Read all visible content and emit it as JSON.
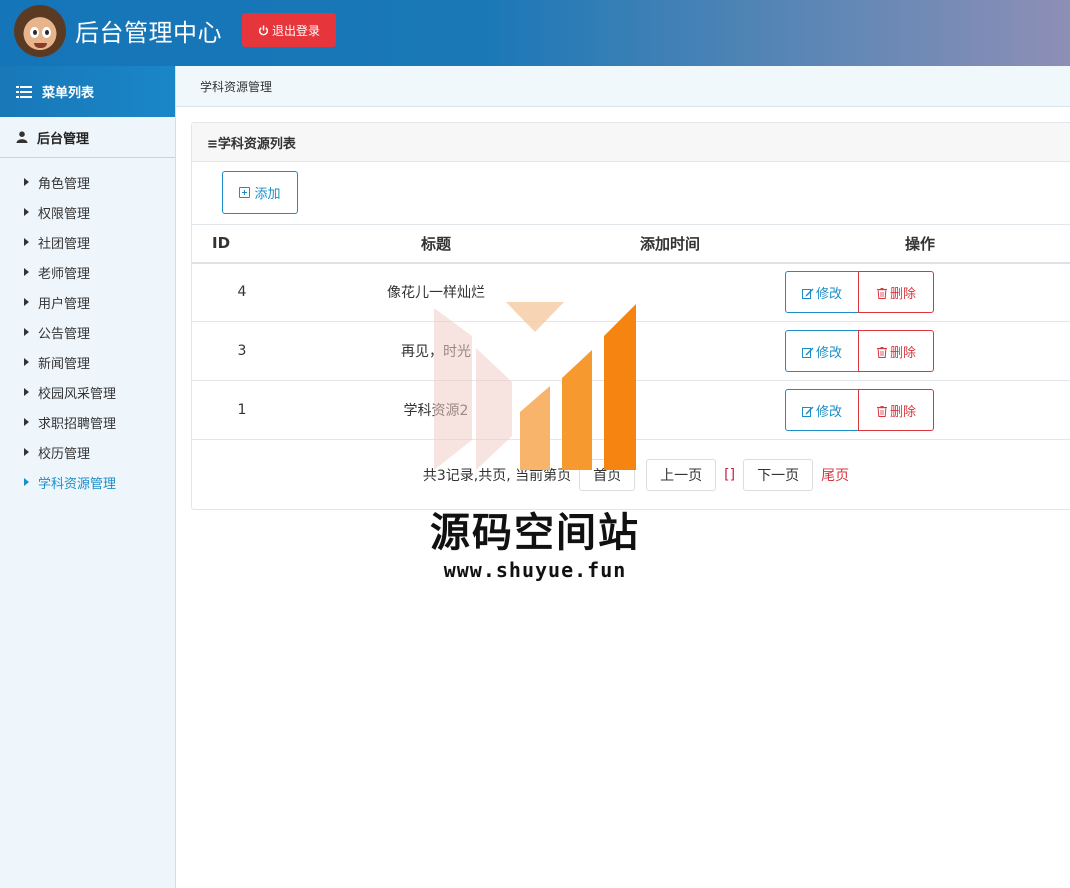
{
  "header": {
    "title": "后台管理中心",
    "logout_label": "退出登录"
  },
  "sidebar": {
    "menu_title": "菜单列表",
    "group_title": "后台管理",
    "items": [
      {
        "label": "角色管理"
      },
      {
        "label": "权限管理"
      },
      {
        "label": "社团管理"
      },
      {
        "label": "老师管理"
      },
      {
        "label": "用户管理"
      },
      {
        "label": "公告管理"
      },
      {
        "label": "新闻管理"
      },
      {
        "label": "校园风采管理"
      },
      {
        "label": "求职招聘管理"
      },
      {
        "label": "校历管理"
      },
      {
        "label": "学科资源管理",
        "active": true
      }
    ]
  },
  "breadcrumb": "学科资源管理",
  "panel": {
    "title": "≡学科资源列表",
    "add_label": "添加"
  },
  "table": {
    "headers": {
      "id": "ID",
      "title": "标题",
      "time": "添加时间",
      "op": "操作"
    },
    "rows": [
      {
        "id": "4",
        "title": "像花儿一样灿烂",
        "time": ""
      },
      {
        "id": "3",
        "title": "再见，时光",
        "time": ""
      },
      {
        "id": "1",
        "title": "学科资源2",
        "time": ""
      }
    ],
    "edit_label": "修改",
    "delete_label": "删除"
  },
  "pager": {
    "info": "共3记录,共页, 当前第页",
    "first": "首页",
    "prev": "上一页",
    "current": "[]",
    "next": "下一页",
    "last": "尾页"
  },
  "watermark": {
    "name": "源码空间站",
    "url": "www.shuyue.fun"
  },
  "colors": {
    "header_start": "#1475b9",
    "header_end": "#8e8fb6",
    "accent": "#1b8ec7",
    "danger": "#e6353b"
  }
}
